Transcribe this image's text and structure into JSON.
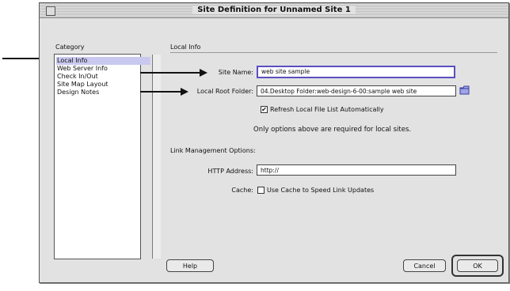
{
  "dialog": {
    "title": "Site Definition for Unnamed Site 1",
    "category_label": "Category",
    "section_label": "Local Info",
    "categories": [
      {
        "label": "Local Info",
        "selected": true
      },
      {
        "label": "Web Server Info",
        "selected": false
      },
      {
        "label": "Check In/Out",
        "selected": false
      },
      {
        "label": "Site Map Layout",
        "selected": false
      },
      {
        "label": "Design Notes",
        "selected": false
      }
    ],
    "site_name": {
      "label": "Site Name:",
      "value": "web site sample"
    },
    "local_root": {
      "label": "Local Root Folder:",
      "value": "04.Desktop Folder:web-design-6-00:sample web site"
    },
    "refresh": {
      "label": "Refresh Local File List Automatically",
      "checked": true
    },
    "note": "Only options above are required for local sites.",
    "link_mgmt_label": "Link Management Options:",
    "http": {
      "label": "HTTP Address:",
      "value": "http://"
    },
    "cache": {
      "label": "Cache:",
      "checkbox_label": "Use Cache to Speed Link Updates",
      "checked": false
    },
    "buttons": {
      "help": "Help",
      "cancel": "Cancel",
      "ok": "OK"
    }
  }
}
